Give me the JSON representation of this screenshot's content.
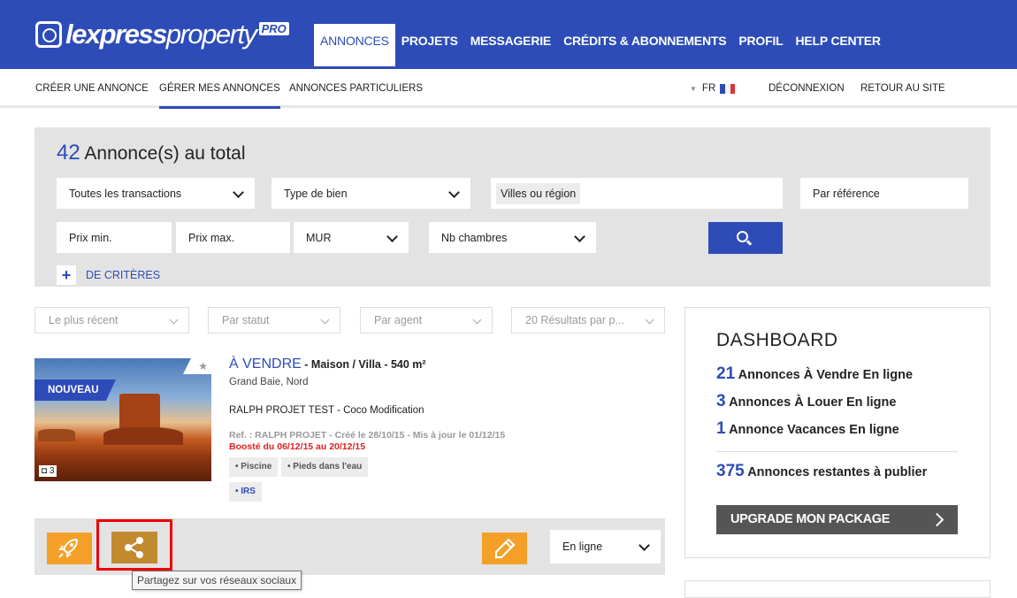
{
  "header": {
    "logo_main": "lexpress",
    "logo_light": "property",
    "logo_pro": "PRO",
    "nav": [
      "ANNONCES",
      "PROJETS",
      "MESSAGERIE",
      "CRÉDITS & ABONNEMENTS",
      "PROFIL",
      "HELP CENTER"
    ],
    "active_nav": "ANNONCES"
  },
  "subnav": {
    "items": [
      "CRÉER UNE ANNONCE",
      "GÉRER MES ANNONCES",
      "ANNONCES PARTICULIERS"
    ],
    "active": "GÉRER MES ANNONCES",
    "lang": "FR",
    "logout": "DÉCONNEXION",
    "back": "RETOUR AU SITE",
    "flag_colors": [
      "#2b4bb0",
      "#ffffff",
      "#e0303a"
    ]
  },
  "search": {
    "count": "42",
    "count_label": "Annonce(s) au total",
    "transactions": "Toutes les transactions",
    "type": "Type de bien",
    "villes": "Villes ou région",
    "reference": "Par référence",
    "prix_min": "Prix min.",
    "prix_max": "Prix max.",
    "currency": "MUR",
    "chambres": "Nb chambres",
    "more_label": "DE CRITÈRES",
    "more_plus": "+"
  },
  "filters": [
    "Le plus récent",
    "Par statut",
    "Par agent",
    "20 Résultats par p..."
  ],
  "listing": {
    "badge": "NOUVEAU",
    "photo_count": "3",
    "title": "À VENDRE",
    "subtitle": " - Maison / Villa - 540 m²",
    "location": "Grand Baie, Nord",
    "owner": "RALPH PROJET TEST - Coco Modification",
    "meta": "Ref. : RALPH PROJET - Créé le 28/10/15 - Mis à jour le 01/12/15",
    "boost": "Boosté du 06/12/15 au 20/12/15",
    "tags": [
      "• Piscine",
      "• Pieds dans l'eau"
    ],
    "tag_irs": "• IRS",
    "status": "En ligne",
    "tooltip": "Partagez sur vos réseaux sociaux"
  },
  "dashboard": {
    "title": "DASHBOARD",
    "rows": [
      {
        "n": "21",
        "label": "Annonces À Vendre En ligne"
      },
      {
        "n": "3",
        "label": "Annonces À Louer En ligne"
      },
      {
        "n": "1",
        "label": "Annonce Vacances En ligne"
      }
    ],
    "remaining_n": "375",
    "remaining_label": "Annonces restantes à publier",
    "upgrade": "UPGRADE MON PACKAGE"
  },
  "colors": {
    "brand": "#2d4cb8",
    "action": "#f4a028",
    "share": "#c28a2f",
    "boost": "#e02020"
  },
  "icons": [
    "rocket-icon",
    "share-icon",
    "pencil-icon",
    "search-icon",
    "camera-icon",
    "star-icon",
    "chevron-down-icon",
    "chevron-right-icon"
  ]
}
